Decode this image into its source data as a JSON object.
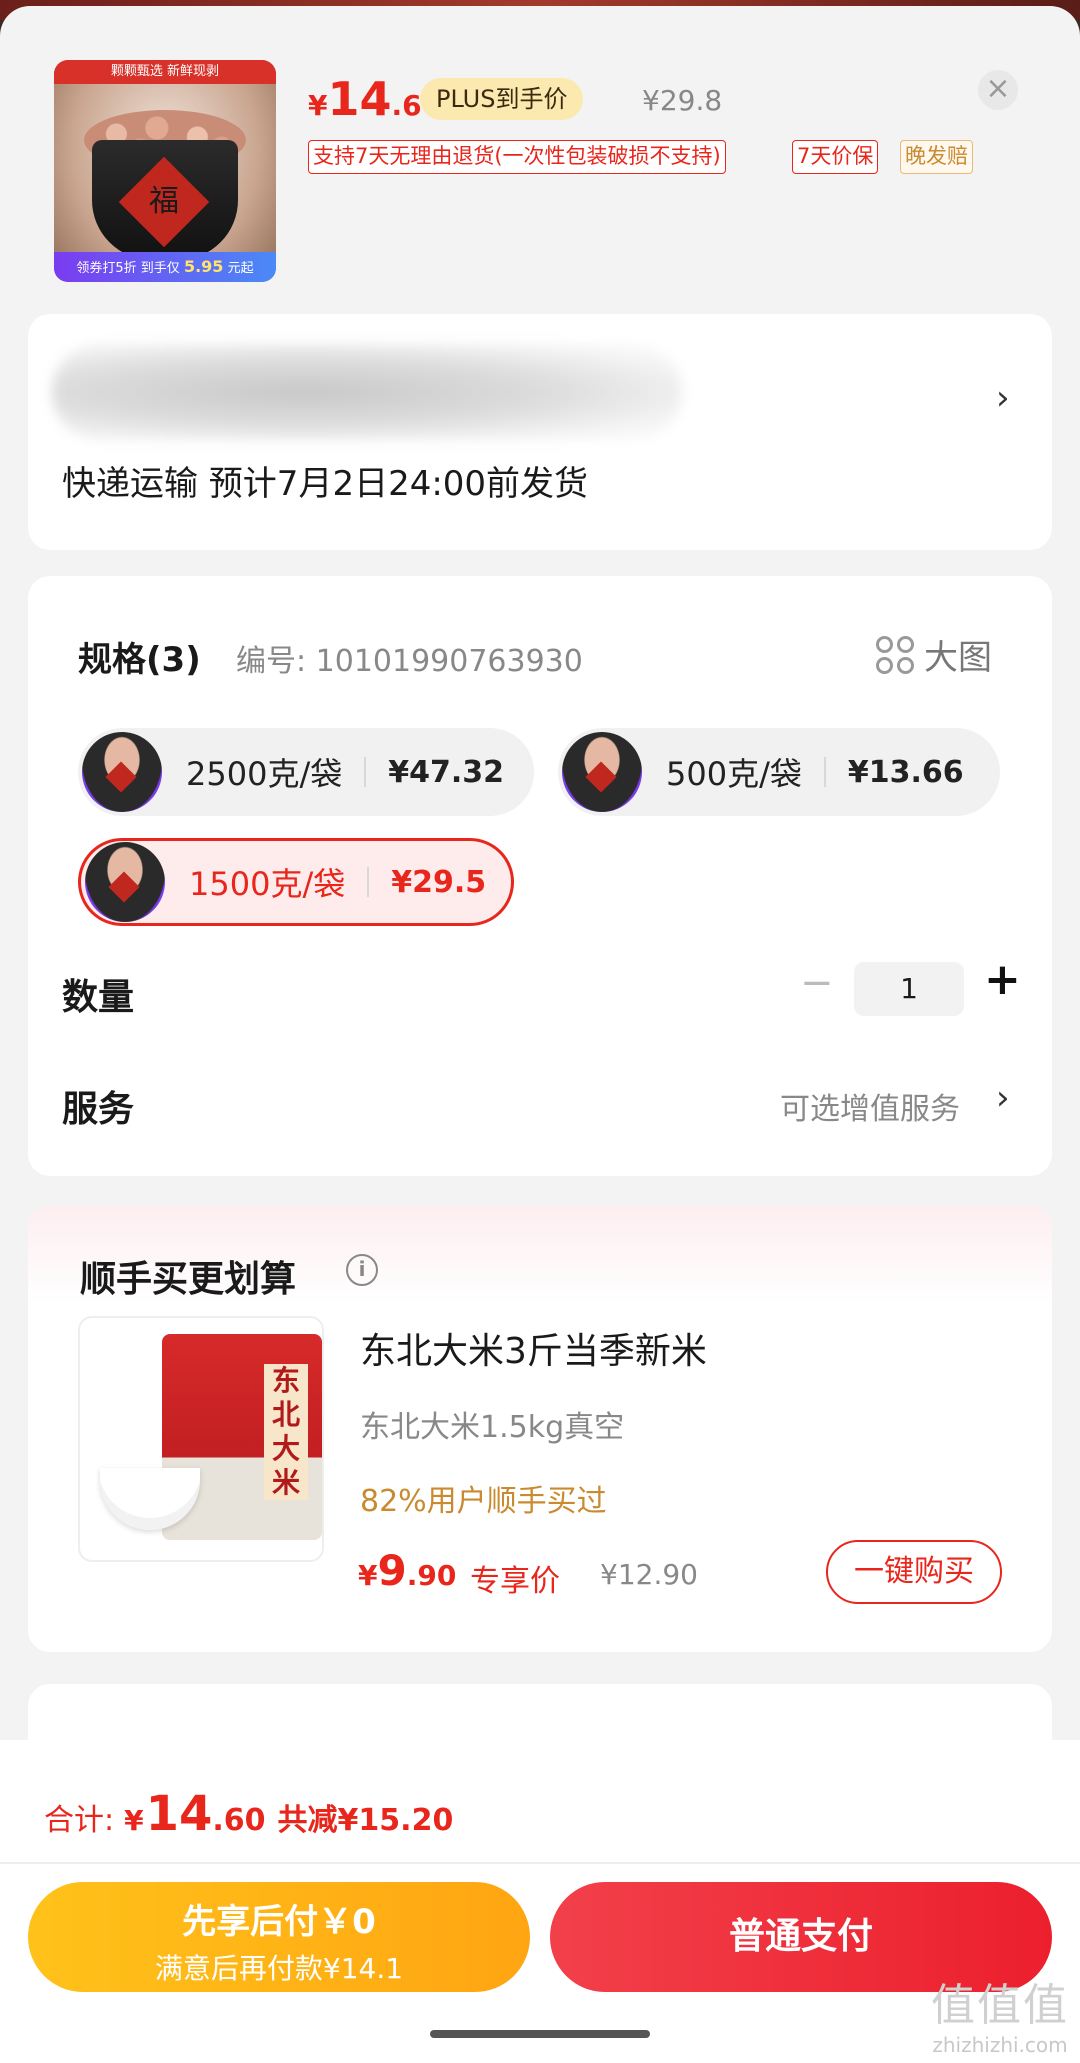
{
  "product": {
    "thumb_top_text": "颗颗甄选 新鲜现剥",
    "thumb_fu": "福",
    "thumb_bottom_text": "领券打5折 到手仅",
    "thumb_bottom_price": "5.95",
    "thumb_bottom_suffix": "元起",
    "price_currency": "¥",
    "price_int": "14",
    "price_dec": ".6",
    "plus_label": "PLUS到手价",
    "original_price": "¥29.8",
    "close_label": "×",
    "tags": [
      "支持7天无理由退货(一次性包装破损不支持)",
      "7天价保",
      "晚发赔"
    ]
  },
  "address": {
    "shipping": "快递运输 预计7月2日24:00前发货",
    "chevron": "›"
  },
  "spec": {
    "title": "规格(3)",
    "code": "编号: 10101990763930",
    "big_image": "大图",
    "options": [
      {
        "name": "2500克/袋",
        "price": "¥47.32",
        "selected": false
      },
      {
        "name": "500克/袋",
        "price": "¥13.66",
        "selected": false
      },
      {
        "name": "1500克/袋",
        "price": "¥29.5",
        "selected": true
      }
    ],
    "quantity_label": "数量",
    "quantity_minus": "−",
    "quantity_value": "1",
    "quantity_plus": "+",
    "service_label": "服务",
    "service_value": "可选增值服务",
    "chevron": "›"
  },
  "addon": {
    "title": "顺手买更划算",
    "info_icon": "i",
    "bag_text": "东北大米",
    "name": "东北大米3斤当季新米",
    "desc": "东北大米1.5kg真空",
    "bought": "82%用户顺手买过",
    "price_currency": "¥",
    "price_int": "9",
    "price_dec": ".90",
    "exclusive": "专享价",
    "original_price": "¥12.90",
    "buy_label": "一键购买"
  },
  "footer": {
    "total_label": "合计:",
    "total_currency": "¥",
    "total_int": "14",
    "total_dec": ".60",
    "saving": "共减¥15.20",
    "pay_later_title": "先享后付￥0",
    "pay_later_sub": "满意后再付款¥14.1",
    "pay_normal": "普通支付"
  },
  "watermark": {
    "big": "值值值",
    "small": "zhizhizhi.com"
  },
  "colors": {
    "accent": "#e8261c",
    "pay_later": "#ffb316",
    "pay_normal": "#ef2f3b",
    "gold_text": "#c98a30"
  }
}
